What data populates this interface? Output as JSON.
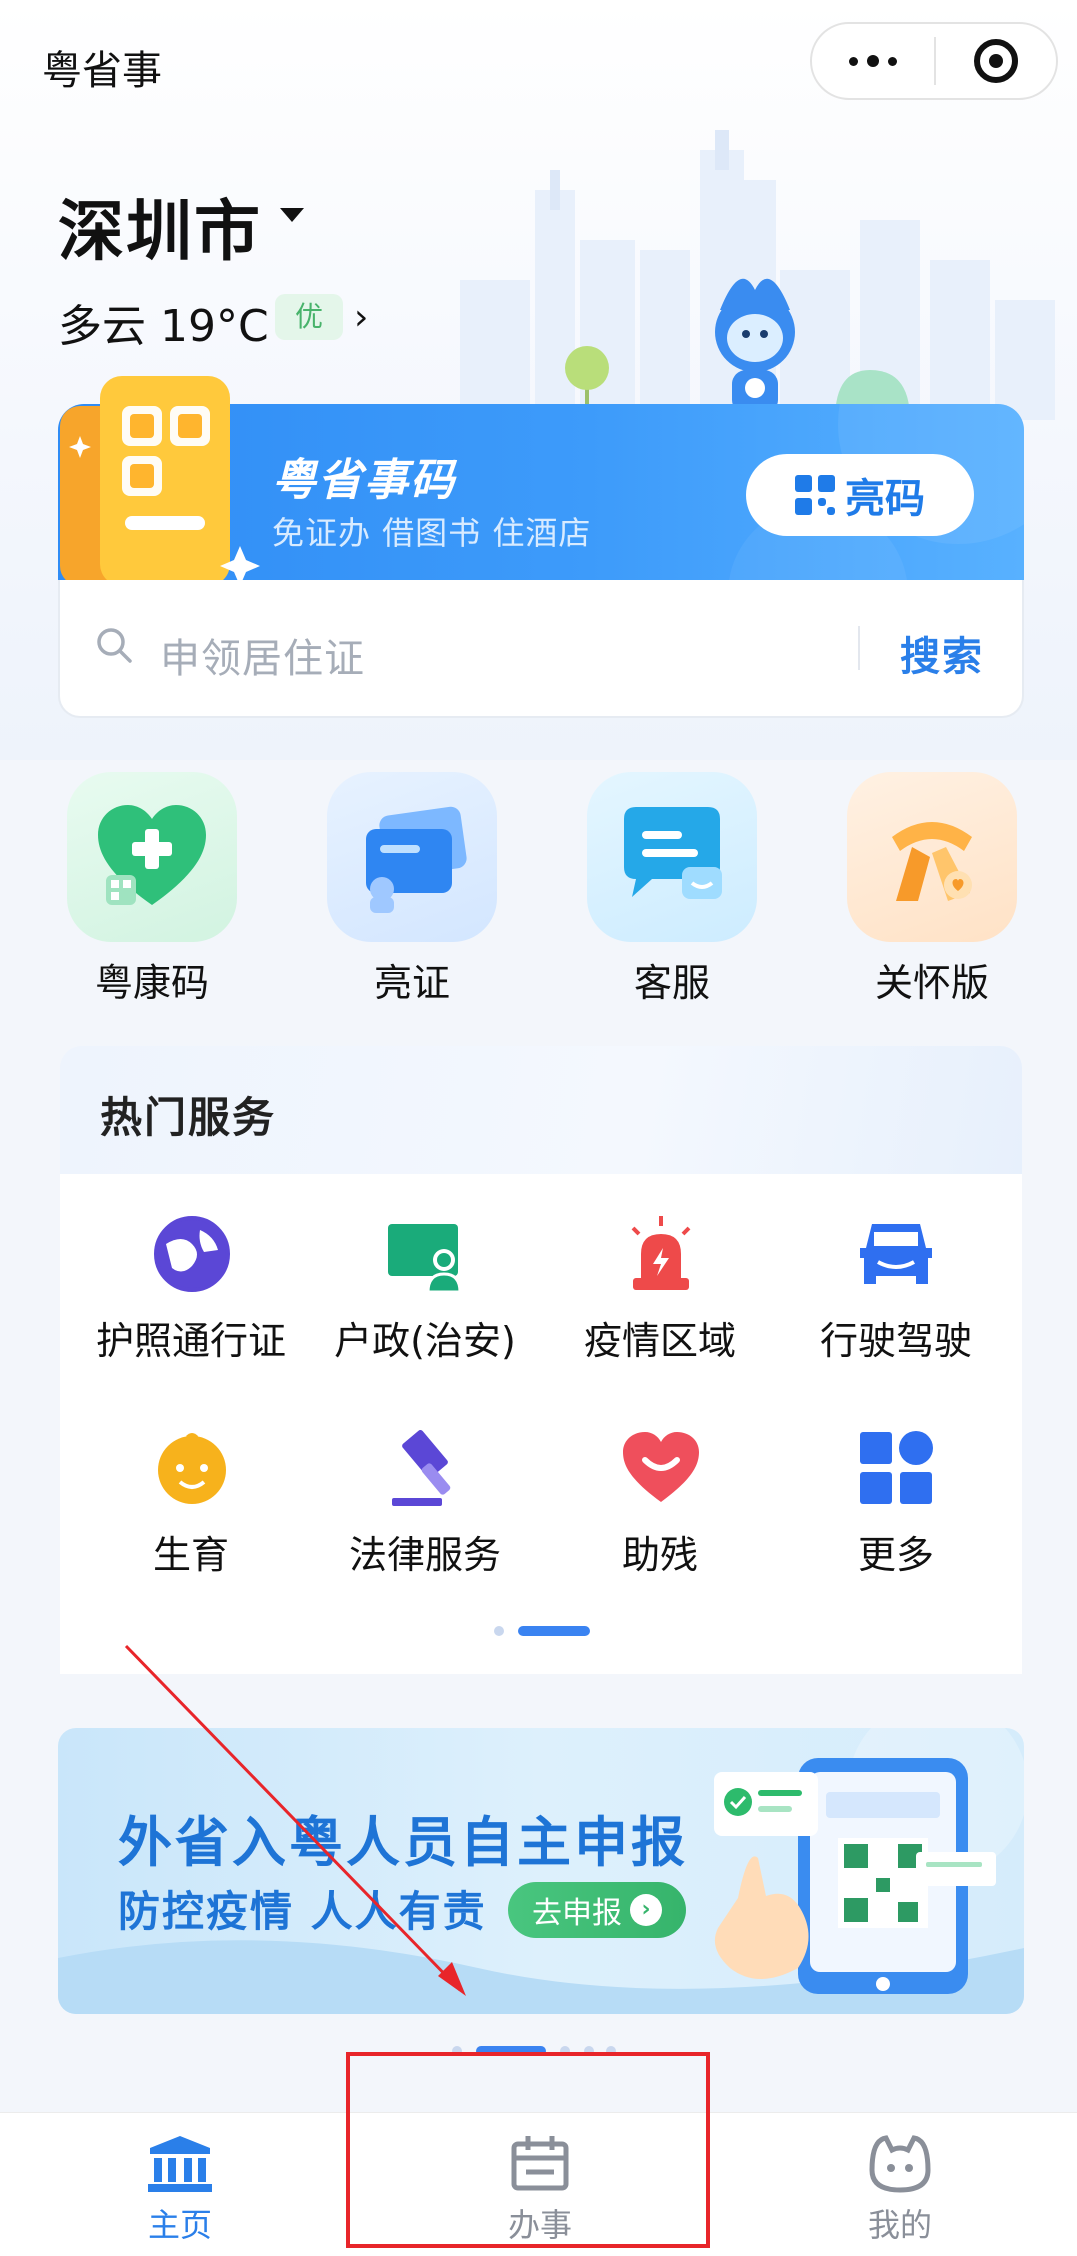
{
  "app": {
    "title": "粤省事"
  },
  "capsule": {
    "more_icon": "more-dots-icon",
    "close_icon": "target-circle-icon"
  },
  "location": {
    "city": "深圳市",
    "weather": "多云 19°C",
    "aqi": "优",
    "arrow": "›"
  },
  "code_card": {
    "title": "粤省事码",
    "subtitle": "免证办 借图书 住酒店",
    "button_label": "亮码"
  },
  "search": {
    "placeholder": "申领居住证",
    "button_label": "搜索"
  },
  "quick_actions": [
    {
      "label": "粤康码",
      "icon": "health-heart-icon"
    },
    {
      "label": "亮证",
      "icon": "cards-icon"
    },
    {
      "label": "客服",
      "icon": "chat-bubble-icon"
    },
    {
      "label": "关怀版",
      "icon": "scarf-icon"
    }
  ],
  "hot_services": {
    "title": "热门服务",
    "items": [
      {
        "label": "护照通行证",
        "icon": "passport-globe-icon"
      },
      {
        "label": "户政(治安)",
        "icon": "id-person-icon"
      },
      {
        "label": "疫情区域",
        "icon": "alarm-light-icon"
      },
      {
        "label": "行驶驾驶",
        "icon": "car-icon"
      },
      {
        "label": "生育",
        "icon": "baby-face-icon"
      },
      {
        "label": "法律服务",
        "icon": "gavel-icon"
      },
      {
        "label": "助残",
        "icon": "heart-smile-icon"
      },
      {
        "label": "更多",
        "icon": "grid-more-icon"
      }
    ],
    "page_count": 2,
    "active_page": 2
  },
  "promo": {
    "title": "外省入粤人员自主申报",
    "subtitle": "防控疫情 人人有责",
    "button_label": "去申报"
  },
  "tabbar": {
    "items": [
      {
        "label": "主页",
        "icon": "government-building-icon",
        "active": true
      },
      {
        "label": "办事",
        "icon": "calendar-icon",
        "active": false
      },
      {
        "label": "我的",
        "icon": "mascot-face-icon",
        "active": false
      }
    ]
  },
  "colors": {
    "primary": "#2a7fe9",
    "tab_active": "#2a7fe9",
    "tab_inactive": "#8a8f99",
    "annotation": "#e8252a"
  }
}
